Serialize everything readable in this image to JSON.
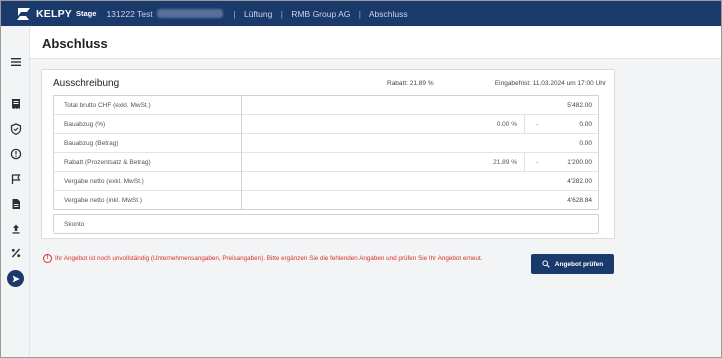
{
  "app": {
    "brand": "KELPY",
    "stage": "Stage",
    "breadcrumb": {
      "project": "131222 Test",
      "section": "Lüftung",
      "company": "RMB Group AG",
      "current": "Abschluss"
    }
  },
  "page": {
    "title": "Abschluss"
  },
  "tender": {
    "title": "Ausschreibung",
    "rabatt_label": "Rabatt: 21.89 %",
    "deadline_label": "Eingabefrist: 11.03.2024 um 17:00 Uhr",
    "rows": [
      {
        "label": "Total brutto CHF (exkl. MwSt.)",
        "percent": "",
        "dash": "",
        "amount": "5'482.00"
      },
      {
        "label": "Bauabzug (%)",
        "percent": "0.00 %",
        "dash": "-",
        "amount": "0.00"
      },
      {
        "label": "Bauabzug (Betrag)",
        "percent": "",
        "dash": "",
        "amount": "0.00"
      },
      {
        "label": "Rabatt (Prozentsatz & Betrag)",
        "percent": "21.89 %",
        "dash": "-",
        "amount": "1'200.00"
      },
      {
        "label": "Vergabe netto (exkl. MwSt.)",
        "percent": "",
        "dash": "",
        "amount": "4'282.00"
      },
      {
        "label": "Vergabe netto (inkl. MwSt.)",
        "percent": "",
        "dash": "",
        "amount": "4'628.84"
      }
    ],
    "skonto_label": "Skonto"
  },
  "warning": {
    "text": "Ihr Angebot ist noch unvollständig (Unternehmensangaben, Preisangaben). Bitte ergänzen Sie die fehlenden Angaben und prüfen Sie Ihr Angebot erneut."
  },
  "actions": {
    "check_offer": "Angebot prüfen"
  },
  "colors": {
    "primary": "#1a3a6b",
    "warning": "#d6332b",
    "background": "#f3f4f6"
  },
  "icons": {
    "rail": [
      "menu-icon",
      "receipt-icon",
      "shield-icon",
      "info-icon",
      "flag-icon",
      "document-icon",
      "upload-icon",
      "percent-icon",
      "send-icon"
    ]
  }
}
